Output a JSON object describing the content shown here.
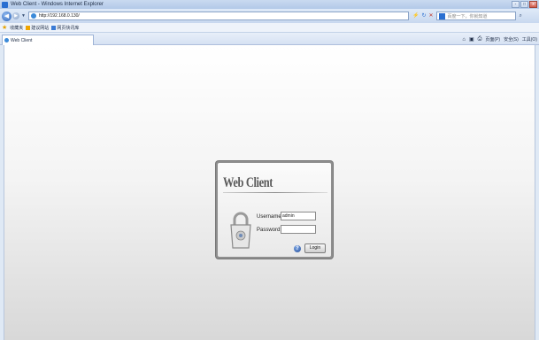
{
  "window": {
    "title": "Web Client - Windows Internet Explorer",
    "controls": [
      "-",
      "□",
      "x"
    ]
  },
  "address_bar": {
    "url": "http://192.168.0.130/",
    "search_placeholder": "百度一下，你就知道"
  },
  "favorites_bar": {
    "label": "收藏夹",
    "items": [
      "建议网站",
      "网页快讯库"
    ]
  },
  "tab": {
    "label": "Web Client"
  },
  "command_bar": {
    "items": [
      "页面(P)",
      "安全(S)",
      "工具(O)"
    ]
  },
  "login": {
    "brand": "Web Client",
    "username_label": "Username:",
    "username_value": "admin",
    "password_label": "Password:",
    "password_value": "",
    "login_button": "Login",
    "help_icon_text": "?"
  }
}
